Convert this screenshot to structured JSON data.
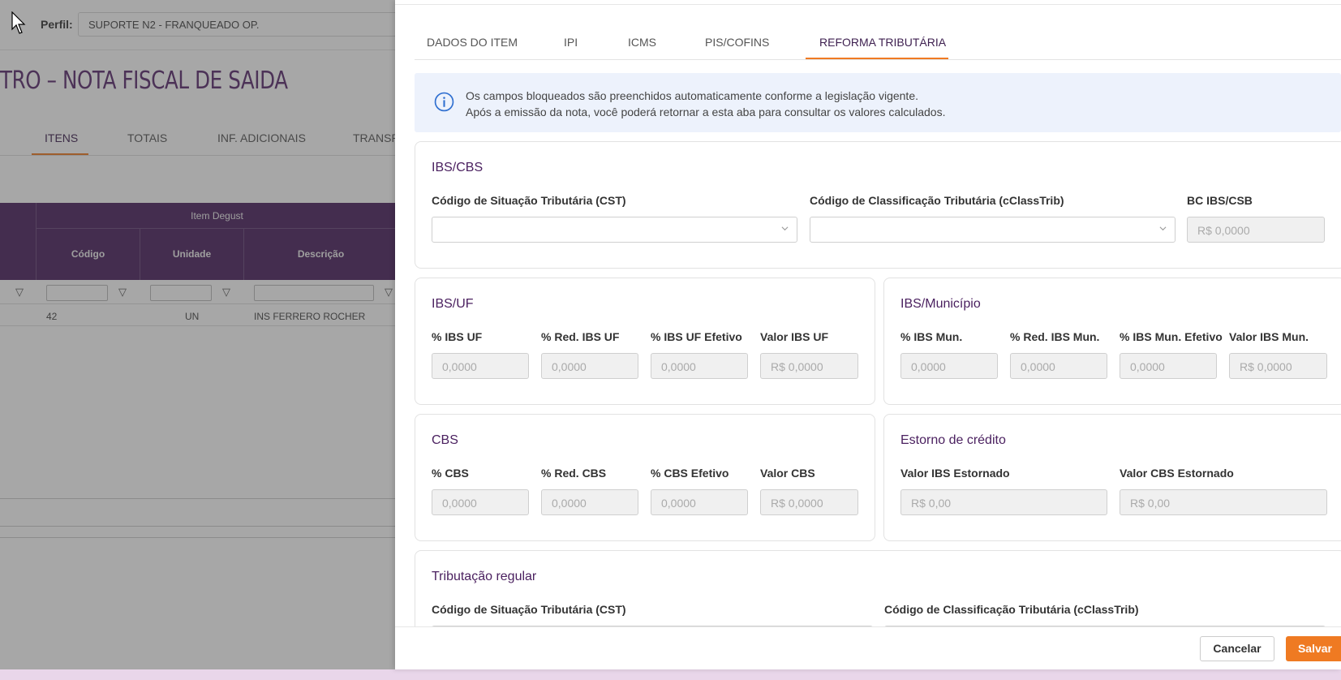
{
  "background": {
    "perfil_label": "Perfil:",
    "perfil_value": "SUPORTE N2 - FRANQUEADO OP.",
    "page_title": "TRO – NOTA FISCAL DE SAIDA",
    "tabs": [
      "ITENS",
      "TOTAIS",
      "INF. ADICIONAIS",
      "TRANSP"
    ],
    "grid_group": "Item Degust",
    "grid_columns": [
      "Código",
      "Unidade",
      "Descrição"
    ],
    "row": {
      "codigo": "42",
      "unidade": "UN",
      "descricao": "INS FERRERO ROCHER"
    }
  },
  "tabs": {
    "dados": "DADOS DO ITEM",
    "ipi": "IPI",
    "icms": "ICMS",
    "pis": "PIS/COFINS",
    "reforma": "REFORMA TRIBUTÁRIA"
  },
  "info": {
    "line1": "Os campos bloqueados são preenchidos automaticamente conforme a legislação vigente.",
    "line2": "Após a emissão da nota, você poderá retornar a esta aba para consultar os valores calculados."
  },
  "ibs_cbs": {
    "title": "IBS/CBS",
    "cst_label": "Código de Situação Tributária (CST)",
    "cclass_label": "Código de Classificação Tributária (cClassTrib)",
    "bc_label": "BC IBS/CSB",
    "bc_value": "R$ 0,0000"
  },
  "ibs_uf": {
    "title": "IBS/UF",
    "labels": [
      "% IBS UF",
      "% Red. IBS UF",
      "% IBS UF Efetivo",
      "Valor IBS UF"
    ],
    "values": [
      "0,0000",
      "0,0000",
      "0,0000",
      "R$ 0,0000"
    ]
  },
  "ibs_mun": {
    "title": "IBS/Município",
    "labels": [
      "% IBS Mun.",
      "% Red. IBS Mun.",
      "% IBS Mun. Efetivo",
      "Valor IBS Mun."
    ],
    "values": [
      "0,0000",
      "0,0000",
      "0,0000",
      "R$ 0,0000"
    ]
  },
  "cbs": {
    "title": "CBS",
    "labels": [
      "% CBS",
      "% Red. CBS",
      "% CBS Efetivo",
      "Valor CBS"
    ],
    "values": [
      "0,0000",
      "0,0000",
      "0,0000",
      "R$ 0,0000"
    ]
  },
  "estorno": {
    "title": "Estorno de crédito",
    "labels": [
      "Valor IBS Estornado",
      "Valor CBS Estornado"
    ],
    "values": [
      "R$ 0,00",
      "R$ 0,00"
    ]
  },
  "regular": {
    "title": "Tributação regular",
    "cst_label": "Código de Situação Tributária (CST)",
    "cclass_label": "Código de Classificação Tributária (cClassTrib)"
  },
  "buttons": {
    "cancel": "Cancelar",
    "save": "Salvar"
  },
  "colors": {
    "accent": "#ef7a22",
    "brand": "#4b2160",
    "info_bg": "#edf2fc"
  }
}
